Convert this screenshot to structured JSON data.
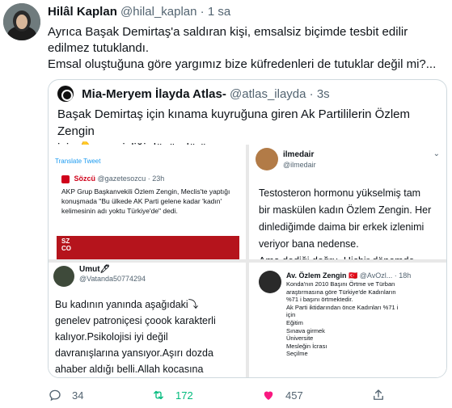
{
  "tweet": {
    "author_name": "Hilâl Kaplan",
    "author_handle": "@hilal_kaplan",
    "separator": "·",
    "time": "1 sa",
    "text_lines": [
      "Ayrıca Başak Demirtaş'a saldıran kişi, emsalsiz biçimde tesbit edilir edilmez tutuklandı.",
      "Emsal oluştuğuna göre yargımız bize küfredenleri de tutuklar değil mi?..."
    ]
  },
  "quote": {
    "author_name": "Mia-Meryem İlayda Atlas-",
    "author_handle": "@atlas_ilayda",
    "separator": "·",
    "time": "3s",
    "text_line1": "Başak Demirtaş için kınama kuyruğuna giren Ak Partililerin Özlem Zengin",
    "text_line2_pre": "için",
    "emoji": "👇",
    "text_line2_post": "sessizliği düşündürüyor."
  },
  "panel_sozcu": {
    "translate": "Translate Tweet",
    "brand": "Sözcü",
    "handle": "@gazetesozcu · 23h",
    "text": "AKP Grup Başkanvekili Özlem Zengin, Meclis'te yaptığı konuşmada \"Bu ülkede AK Parti gelene kadar 'kadın' kelimesinin adı yoktu Türkiye'de\" dedi."
  },
  "panel_ilmedair": {
    "name": "ilmedair",
    "handle": "@ilmedair",
    "more": "⌄",
    "text_lines": [
      "Testosteron hormonu yükselmiş tam",
      "bir maskülen kadın Özlem Zengin. Her",
      "dinlediğimde daima bir erkek izlenimi",
      "veriyor bana nedense.",
      "Ama dediği doğru. Hiçbir dönemde"
    ]
  },
  "panel_umut": {
    "name": "Umut🖊",
    "handle": "@Vatanda50774294",
    "text_lines": [
      "Bu kadının yanında aşağıdaki⤵",
      "genelev patroniçesi çoook karakterli",
      "kalıyor.Psikolojisi iyi değil",
      "davranışlarına yansıyor.Aşırı dozda",
      "ahaber aldığı belli.Allah kocasına"
    ]
  },
  "panel_ozlem": {
    "name": "Av. Özlem Zengin 🇹🇷",
    "handle": "@AvOzl... · 18h",
    "text_lines": [
      "Konda'nın 2010 Başını Örtme ve Türban",
      "araştırmasına göre Türkiye'de Kadınların",
      "%71 i başını örtmektedir.",
      "Ak Parti iktidarından önce Kadınları %71 i",
      "için",
      "Eğitim",
      "Sınava girmek",
      "Üniversite",
      "Mesleğin İcrası",
      "Seçilme"
    ]
  },
  "actions": {
    "reply_count": "34",
    "retweet_count": "172",
    "like_count": "457"
  },
  "colors": {
    "retweet_active": "#00ba7c",
    "secondary_text": "#536471",
    "border": "#cfd9de"
  }
}
